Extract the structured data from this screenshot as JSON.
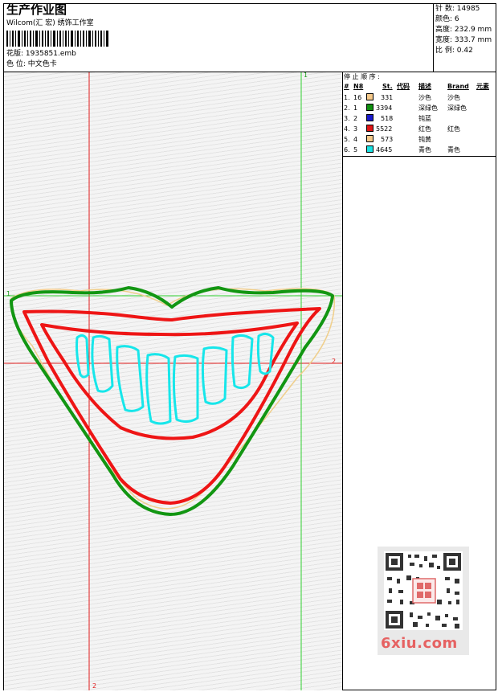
{
  "header": {
    "title": "生产作业图",
    "company": "Wilcom(汇 宏) 绣饰工作室",
    "design_file_label": "花版:",
    "design_file": "1935851.emb",
    "color_card_label": "色 位:",
    "color_card": "中文色卡"
  },
  "stats": {
    "stitches_label": "针 数:",
    "stitches": "14985",
    "colors_label": "颜色:",
    "colors": "6",
    "height_label": "高度:",
    "height": "232.9 mm",
    "width_label": "宽度:",
    "width": "333.7 mm",
    "scale_label": "比 例:",
    "scale": "0.42"
  },
  "stop_sequence": {
    "title": "停 止 顺 序 :",
    "columns": [
      "#",
      "N8",
      "St.",
      "代码",
      "描述",
      "Brand",
      "元素"
    ],
    "rows": [
      {
        "index": "1.",
        "n": "16",
        "color": "#f5c98a",
        "stitches": "331",
        "desc": "沙色",
        "brand": "沙色"
      },
      {
        "index": "2.",
        "n": "1",
        "color": "#0f8f0f",
        "stitches": "3394",
        "desc": "深绿色",
        "brand": "深绿色"
      },
      {
        "index": "3.",
        "n": "2",
        "color": "#1a1acc",
        "stitches": "518",
        "desc": "钝蓝",
        "brand": ""
      },
      {
        "index": "4.",
        "n": "3",
        "color": "#e01515",
        "stitches": "5522",
        "desc": "红色",
        "brand": "红色"
      },
      {
        "index": "5.",
        "n": "4",
        "color": "#f5c98a",
        "stitches": "573",
        "desc": "钝黄",
        "brand": ""
      },
      {
        "index": "6.",
        "n": "5",
        "color": "#19e3e3",
        "stitches": "4645",
        "desc": "青色",
        "brand": "青色"
      }
    ]
  },
  "markers": {
    "green_top": "1",
    "green_left": "1",
    "red_right": "2",
    "red_bottom": "2"
  },
  "watermark": {
    "site": "6xiu.com"
  },
  "colors": {
    "outline_green": "#129612",
    "outline_red": "#ee1515",
    "teeth_cyan": "#17e6ea",
    "guide_green": "#30d030",
    "guide_red": "#e01b1b",
    "sand": "#f0cf8c"
  }
}
